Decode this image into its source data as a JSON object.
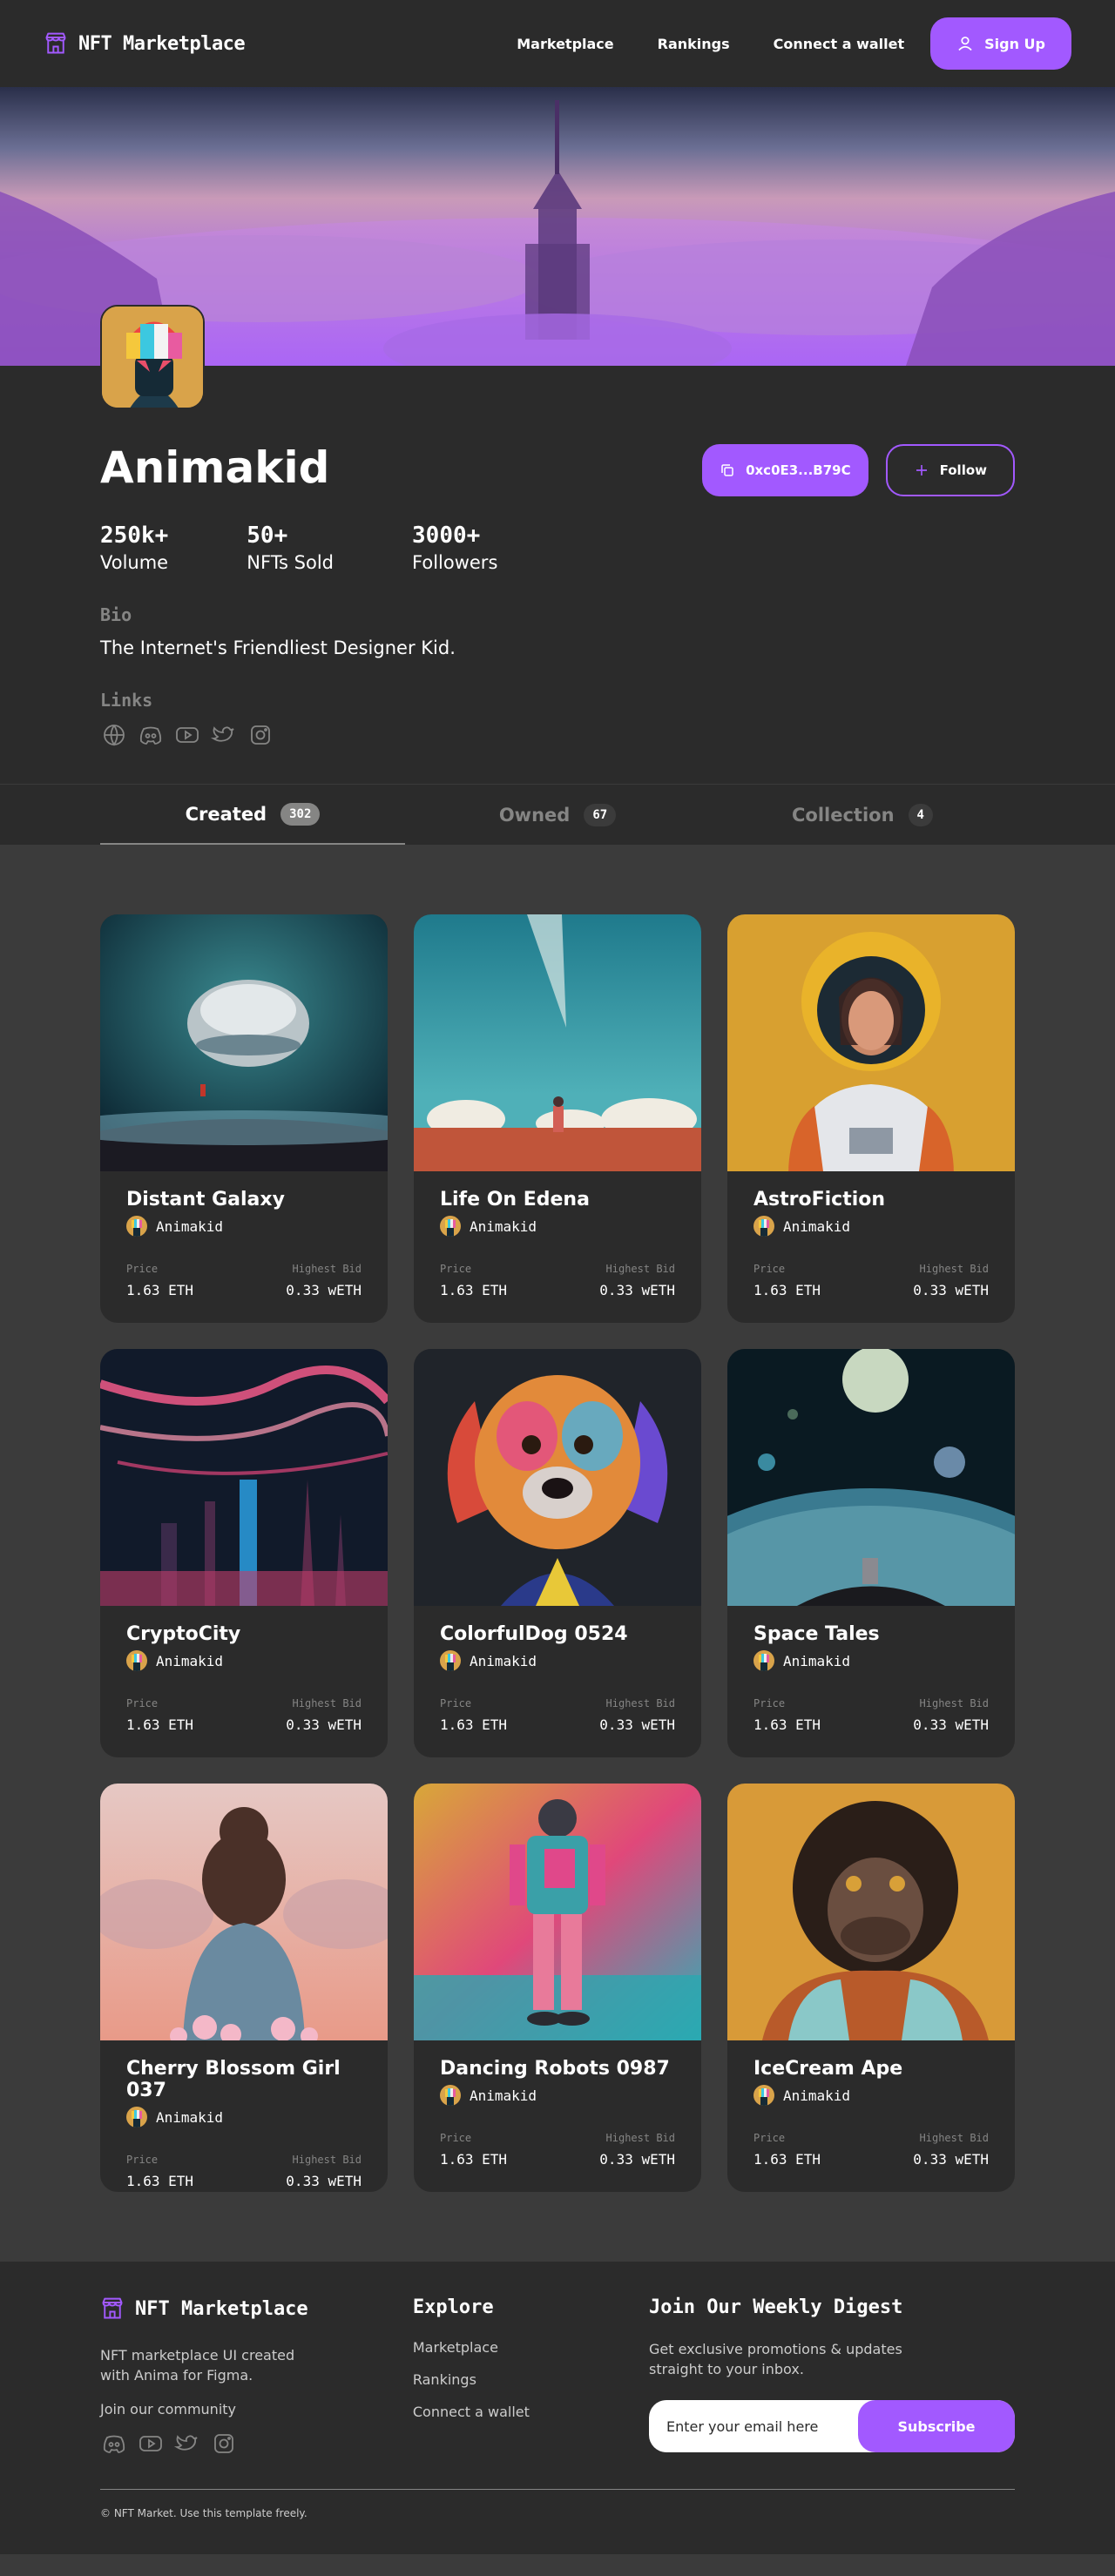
{
  "nav": {
    "brand": "NFT Marketplace",
    "links": [
      "Marketplace",
      "Rankings",
      "Connect a wallet"
    ],
    "signup_label": "Sign Up"
  },
  "profile": {
    "name": "Animakid",
    "wallet_label": "0xc0E3...B79C",
    "follow_label": "Follow",
    "stats": [
      {
        "value": "250k+",
        "label": "Volume"
      },
      {
        "value": "50+",
        "label": "NFTs Sold"
      },
      {
        "value": "3000+",
        "label": "Followers"
      }
    ],
    "bio_heading": "Bio",
    "bio": "The Internet's Friendliest Designer Kid.",
    "links_heading": "Links",
    "link_icons": [
      "globe-icon",
      "discord-icon",
      "youtube-icon",
      "twitter-icon",
      "instagram-icon"
    ]
  },
  "tabs": [
    {
      "label": "Created",
      "count": "302",
      "active": true
    },
    {
      "label": "Owned",
      "count": "67",
      "active": false
    },
    {
      "label": "Collection",
      "count": "4",
      "active": false
    }
  ],
  "cards": [
    {
      "title": "Distant Galaxy",
      "artist": "Animakid",
      "price_label": "Price",
      "price": "1.63 ETH",
      "bid_label": "Highest Bid",
      "bid": "0.33 wETH"
    },
    {
      "title": "Life On Edena",
      "artist": "Animakid",
      "price_label": "Price",
      "price": "1.63 ETH",
      "bid_label": "Highest Bid",
      "bid": "0.33 wETH"
    },
    {
      "title": "AstroFiction",
      "artist": "Animakid",
      "price_label": "Price",
      "price": "1.63 ETH",
      "bid_label": "Highest Bid",
      "bid": "0.33 wETH"
    },
    {
      "title": "CryptoCity",
      "artist": "Animakid",
      "price_label": "Price",
      "price": "1.63 ETH",
      "bid_label": "Highest Bid",
      "bid": "0.33 wETH"
    },
    {
      "title": "ColorfulDog 0524",
      "artist": "Animakid",
      "price_label": "Price",
      "price": "1.63 ETH",
      "bid_label": "Highest Bid",
      "bid": "0.33 wETH"
    },
    {
      "title": "Space Tales",
      "artist": "Animakid",
      "price_label": "Price",
      "price": "1.63 ETH",
      "bid_label": "Highest Bid",
      "bid": "0.33 wETH"
    },
    {
      "title": "Cherry Blossom Girl 037",
      "artist": "Animakid",
      "price_label": "Price",
      "price": "1.63 ETH",
      "bid_label": "Highest Bid",
      "bid": "0.33 wETH"
    },
    {
      "title": "Dancing Robots 0987",
      "artist": "Animakid",
      "price_label": "Price",
      "price": "1.63 ETH",
      "bid_label": "Highest Bid",
      "bid": "0.33 wETH"
    },
    {
      "title": "IceCream Ape",
      "artist": "Animakid",
      "price_label": "Price",
      "price": "1.63 ETH",
      "bid_label": "Highest Bid",
      "bid": "0.33 wETH"
    }
  ],
  "footer": {
    "brand": "NFT Marketplace",
    "description": "NFT marketplace UI created with Anima for Figma.",
    "community_label": "Join our community",
    "social_icons": [
      "discord-icon",
      "youtube-icon",
      "twitter-icon",
      "instagram-icon"
    ],
    "explore_heading": "Explore",
    "explore_links": [
      "Marketplace",
      "Rankings",
      "Connect a wallet"
    ],
    "digest_heading": "Join Our Weekly Digest",
    "digest_description": "Get exclusive promotions & updates straight to your inbox.",
    "email_placeholder": "Enter your email here",
    "subscribe_label": "Subscribe",
    "copyright": "© NFT Market. Use this template freely."
  },
  "colors": {
    "accent": "#A259FF",
    "background": "#3B3B3B",
    "surface": "#2B2B2B",
    "muted": "#858584"
  }
}
